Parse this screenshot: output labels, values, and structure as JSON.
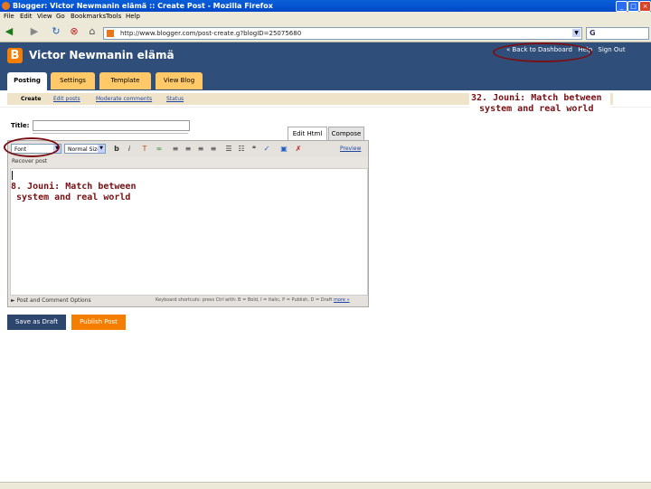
{
  "window": {
    "title": "Blogger: Victor Newmanin elämä :: Create Post - Mozilla Firefox"
  },
  "menu": [
    "File",
    "Edit",
    "View",
    "Go",
    "Bookmarks",
    "Tools",
    "Help"
  ],
  "address": {
    "url": "http://www.blogger.com/post-create.g?blogID=25075680"
  },
  "search": {
    "engine": "G"
  },
  "blog": {
    "logo": "B",
    "name": "Victor Newmanin elämä"
  },
  "toplinks": [
    "« Back to Dashboard",
    "Help",
    "Sign Out"
  ],
  "tabs": [
    "Posting",
    "Settings",
    "Template",
    "View Blog"
  ],
  "subtabs": [
    "Create",
    "Edit posts",
    "Moderate comments",
    "Status"
  ],
  "form": {
    "title_label": "Title:"
  },
  "editor": {
    "tab_html": "Edit Html",
    "tab_compose": "Compose",
    "font": "Font",
    "size": "Normal Size",
    "preview": "Preview",
    "recover": "Recover post",
    "options": "► Post and Comment Options",
    "shortcuts": "Keyboard shortcuts: press Ctrl with: B = Bold, I = Italic, P = Publish, D = Draft",
    "shortcuts_more": "more »"
  },
  "buttons": {
    "save": "Save as Draft",
    "publish": "Publish Post"
  },
  "annotations": {
    "a32_line1": "32. Jouni: Match between",
    "a32_line2": "system and real world",
    "a8_line1": "8. Jouni: Match between",
    "a8_line2": "system and real world"
  },
  "colors": {
    "header": "#2f4f7a",
    "tab": "#ffc96a",
    "orange": "#f57d00",
    "annotation": "#7a0e12"
  }
}
